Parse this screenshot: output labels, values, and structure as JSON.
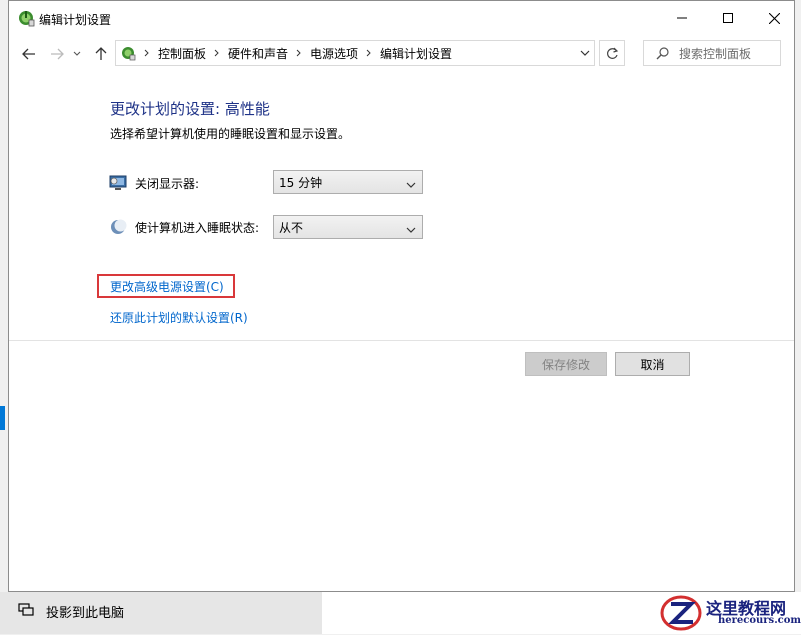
{
  "window": {
    "title": "编辑计划设置",
    "icon": "power-options-icon"
  },
  "address_bar": {
    "breadcrumbs": [
      "控制面板",
      "硬件和声音",
      "电源选项",
      "编辑计划设置"
    ],
    "search_placeholder": "搜索控制面板"
  },
  "content": {
    "heading": "更改计划的设置: 高性能",
    "subheading": "选择希望计算机使用的睡眠设置和显示设置。",
    "settings": [
      {
        "label": "关闭显示器:",
        "value": "15 分钟",
        "icon": "monitor-icon"
      },
      {
        "label": "使计算机进入睡眠状态:",
        "value": "从不",
        "icon": "moon-icon"
      }
    ],
    "links": {
      "advanced": "更改高级电源设置(C)",
      "restore": "还原此计划的默认设置(R)"
    },
    "buttons": {
      "save": "保存修改",
      "cancel": "取消"
    }
  },
  "background": {
    "item_label": "投影到此电脑"
  },
  "watermark": {
    "title": "这里教程网",
    "url": "herecours.com"
  },
  "colors": {
    "heading": "#1e3287",
    "link": "#0066cc",
    "highlight_box": "#d9383a",
    "accent": "#0078d7"
  }
}
